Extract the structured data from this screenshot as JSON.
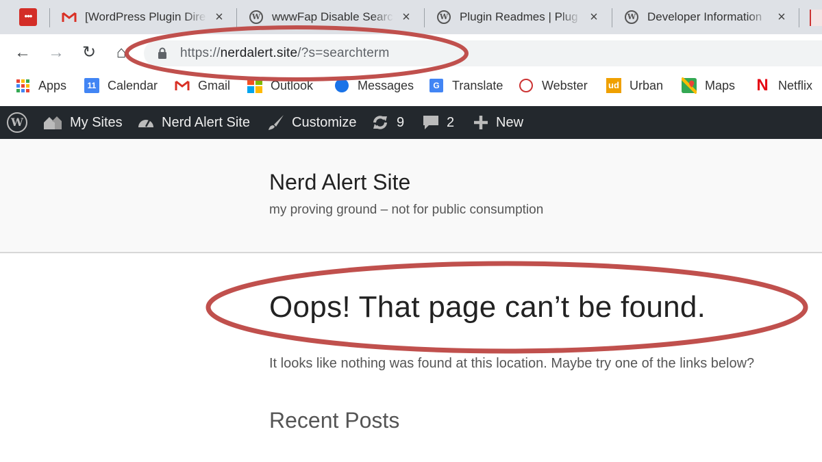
{
  "colors": {
    "tabstrip_bg": "#dee1e6",
    "adminbar_bg": "#23282d",
    "annotation": "#c0504d",
    "ext_red": "#d32d27"
  },
  "tabs": [
    {
      "icon": "gmail-icon",
      "title": "[WordPress Plugin Dire",
      "close": "×"
    },
    {
      "icon": "wordpress-icon",
      "title": "wwwFap Disable Searc",
      "close": "×"
    },
    {
      "icon": "wordpress-icon",
      "title": "Plugin Readmes | Plug",
      "close": "×"
    },
    {
      "icon": "wordpress-icon",
      "title": "Developer Information",
      "close": "×"
    }
  ],
  "toolbar": {
    "back": "←",
    "forward": "→",
    "reload": "↻",
    "home": "⌂",
    "url_scheme": "https://",
    "url_host": "nerdalert.site",
    "url_path": "/?s=searchterm"
  },
  "bookmarks": [
    {
      "label": "Apps",
      "icon": "apps-grid-icon"
    },
    {
      "label": "Calendar",
      "icon": "calendar-icon",
      "badge": "11"
    },
    {
      "label": "Gmail",
      "icon": "gmail-icon"
    },
    {
      "label": "Outlook",
      "icon": "outlook-icon"
    },
    {
      "label": "Messages",
      "icon": "messages-icon"
    },
    {
      "label": "Translate",
      "icon": "translate-icon"
    },
    {
      "label": "Webster",
      "icon": "webster-icon"
    },
    {
      "label": "Urban",
      "icon": "urban-icon",
      "badge": "ud"
    },
    {
      "label": "Maps",
      "icon": "maps-icon"
    },
    {
      "label": "Netflix",
      "icon": "netflix-icon",
      "badge": "N"
    }
  ],
  "adminbar": {
    "my_sites": "My Sites",
    "site_name": "Nerd Alert Site",
    "customize": "Customize",
    "updates_count": "9",
    "comments_count": "2",
    "new": "New"
  },
  "site": {
    "title": "Nerd Alert Site",
    "description": "my proving ground – not for public consumption"
  },
  "content": {
    "page_title": "Oops! That page can’t be found.",
    "page_text": "It looks like nothing was found at this location. Maybe try one of the links below?",
    "widget_title": "Recent Posts"
  }
}
